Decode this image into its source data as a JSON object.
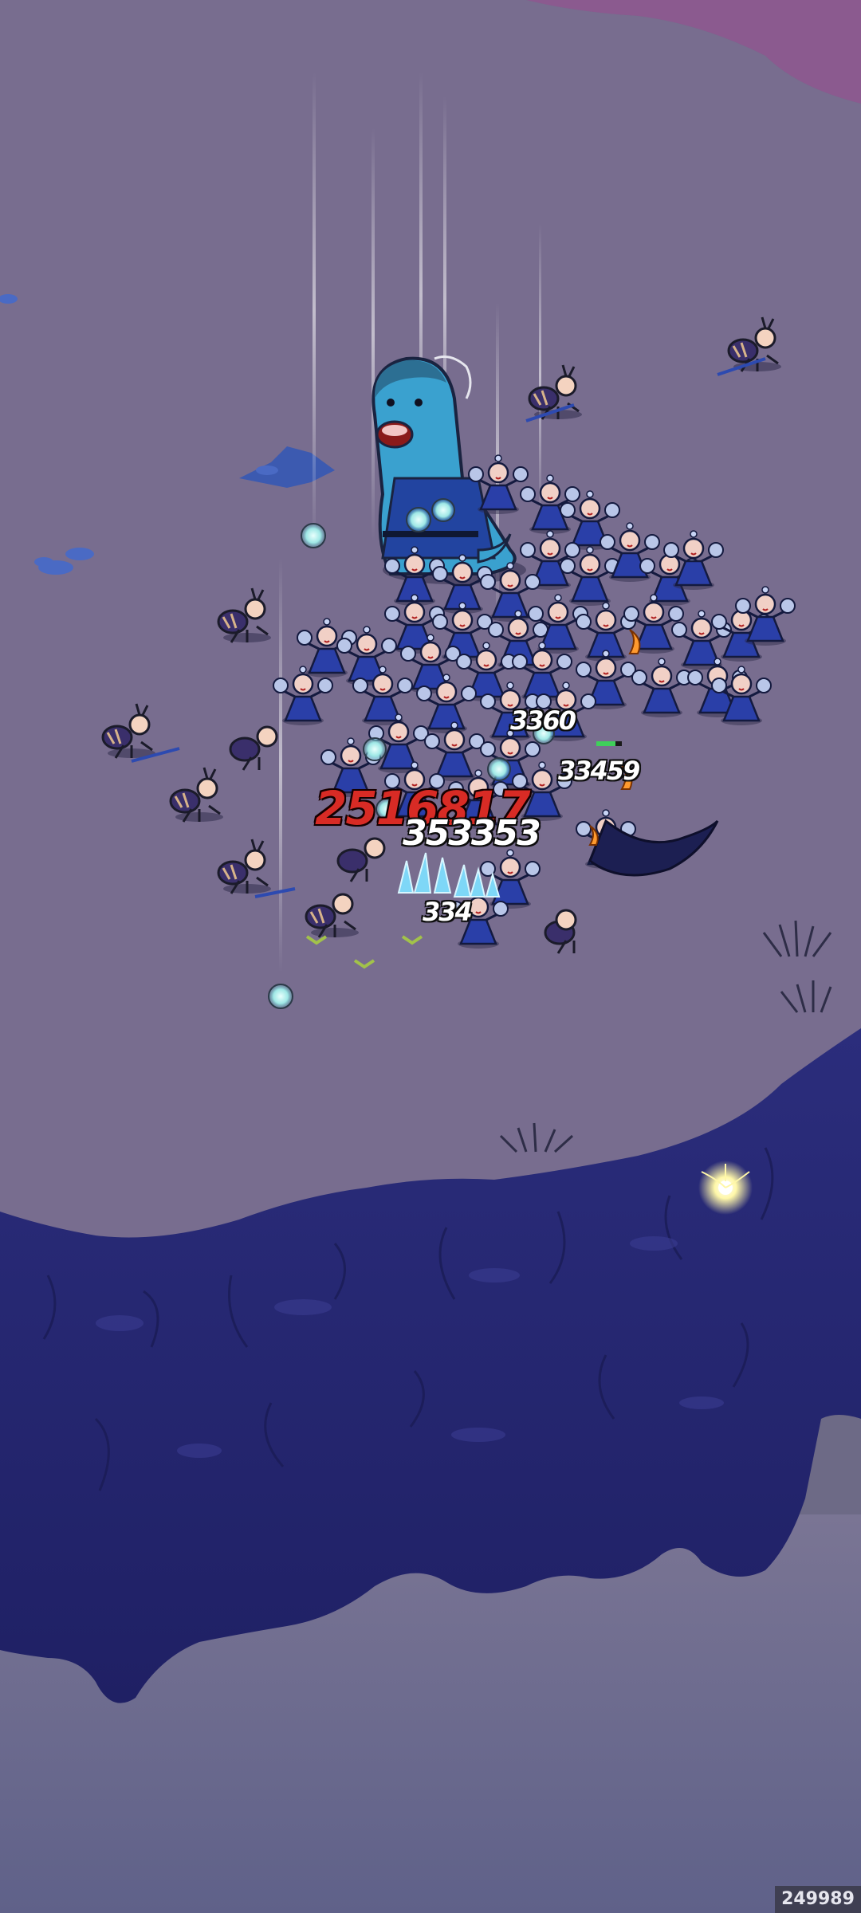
{
  "scene": {
    "palette": {
      "ground": "#786d8f",
      "cliff": "#27286f",
      "sky_haze": "#6d6a86",
      "purple_corner": "#8b5a8f",
      "enemy_blue": "#2a3fa8",
      "damage_red": "#d82b25",
      "orb_cyan": "#9fe8e6"
    },
    "damage_numbers": {
      "big_red": "2516817",
      "row_main": "353353",
      "upper": "3360",
      "upper_right": "33459",
      "lower": "334"
    },
    "sprites": [
      "fish-boss-icon",
      "ant-warrior-icon",
      "blue-dancer-icon",
      "spirit-orb-icon",
      "ice-crystal-icon",
      "light-beam-icon",
      "grass-tuft-icon",
      "sparkle-icon"
    ]
  },
  "watermark": {
    "id_text": "249989"
  }
}
